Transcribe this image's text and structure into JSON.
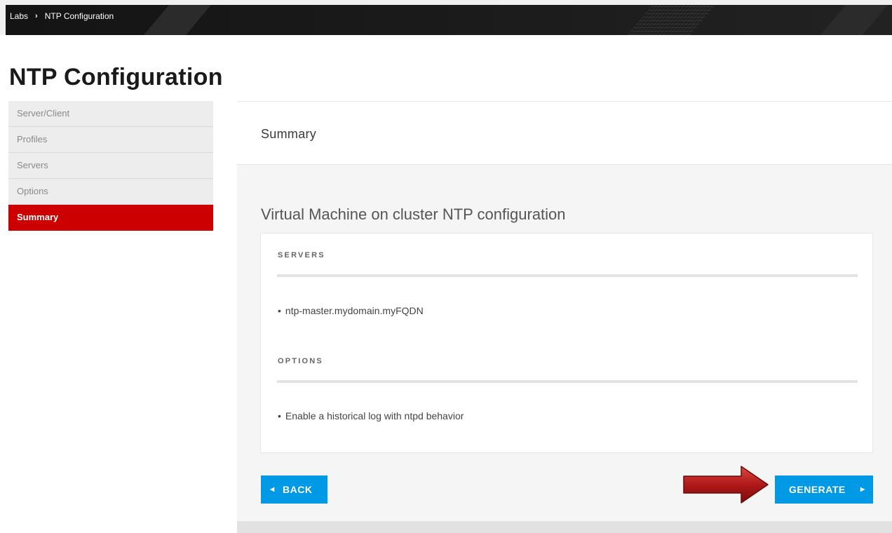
{
  "breadcrumb": {
    "items": [
      "Labs",
      "NTP Configuration"
    ],
    "separator": "›"
  },
  "page_title": "NTP Configuration",
  "sidebar": {
    "items": [
      {
        "label": "Server/Client",
        "active": false
      },
      {
        "label": "Profiles",
        "active": false
      },
      {
        "label": "Servers",
        "active": false
      },
      {
        "label": "Options",
        "active": false
      },
      {
        "label": "Summary",
        "active": true
      }
    ]
  },
  "panel": {
    "header_title": "Summary",
    "section_title": "Virtual Machine on cluster NTP configuration",
    "servers": {
      "label": "SERVERS",
      "items": [
        "ntp-master.mydomain.myFQDN"
      ]
    },
    "options": {
      "label": "OPTIONS",
      "items": [
        "Enable a historical log with ntpd behavior"
      ]
    },
    "back_button": {
      "label": "BACK",
      "icon": "caret-left-icon"
    },
    "generate_button": {
      "label": "GENERATE",
      "icon": "caret-right-icon"
    }
  },
  "annotation": {
    "icon": "red-arrow-icon",
    "points_to": "GENERATE"
  },
  "colors": {
    "accent": "#0099e6",
    "active_nav": "#cc0000",
    "topbar": "#1a1a1a",
    "annotation_arrow": "#b01010"
  }
}
